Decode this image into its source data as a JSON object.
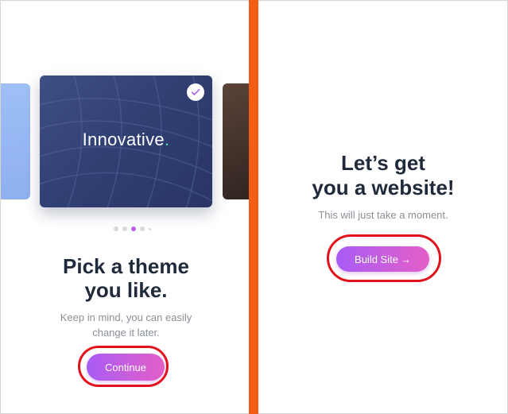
{
  "theme_picker": {
    "featured_card_title": "Innovative",
    "card_dot_color": "#4fe3a1",
    "pager": {
      "count": 5,
      "active_index": 2
    },
    "heading_line1": "Pick a theme",
    "heading_line2": "you like.",
    "subtext_line1": "Keep in mind, you can easily",
    "subtext_line2": "change it later.",
    "continue_label": "Continue"
  },
  "build_site": {
    "heading_line1": "Let’s get",
    "heading_line2": "you a website!",
    "subtext": "This will just take a moment.",
    "button_label": "Build Site",
    "button_arrow": "→"
  },
  "colors": {
    "accent_start": "#a85cf5",
    "accent_end": "#e45fc7",
    "divider": "#f45d13",
    "highlight_ring": "#e2111b",
    "heading_text": "#1f2a3b"
  }
}
